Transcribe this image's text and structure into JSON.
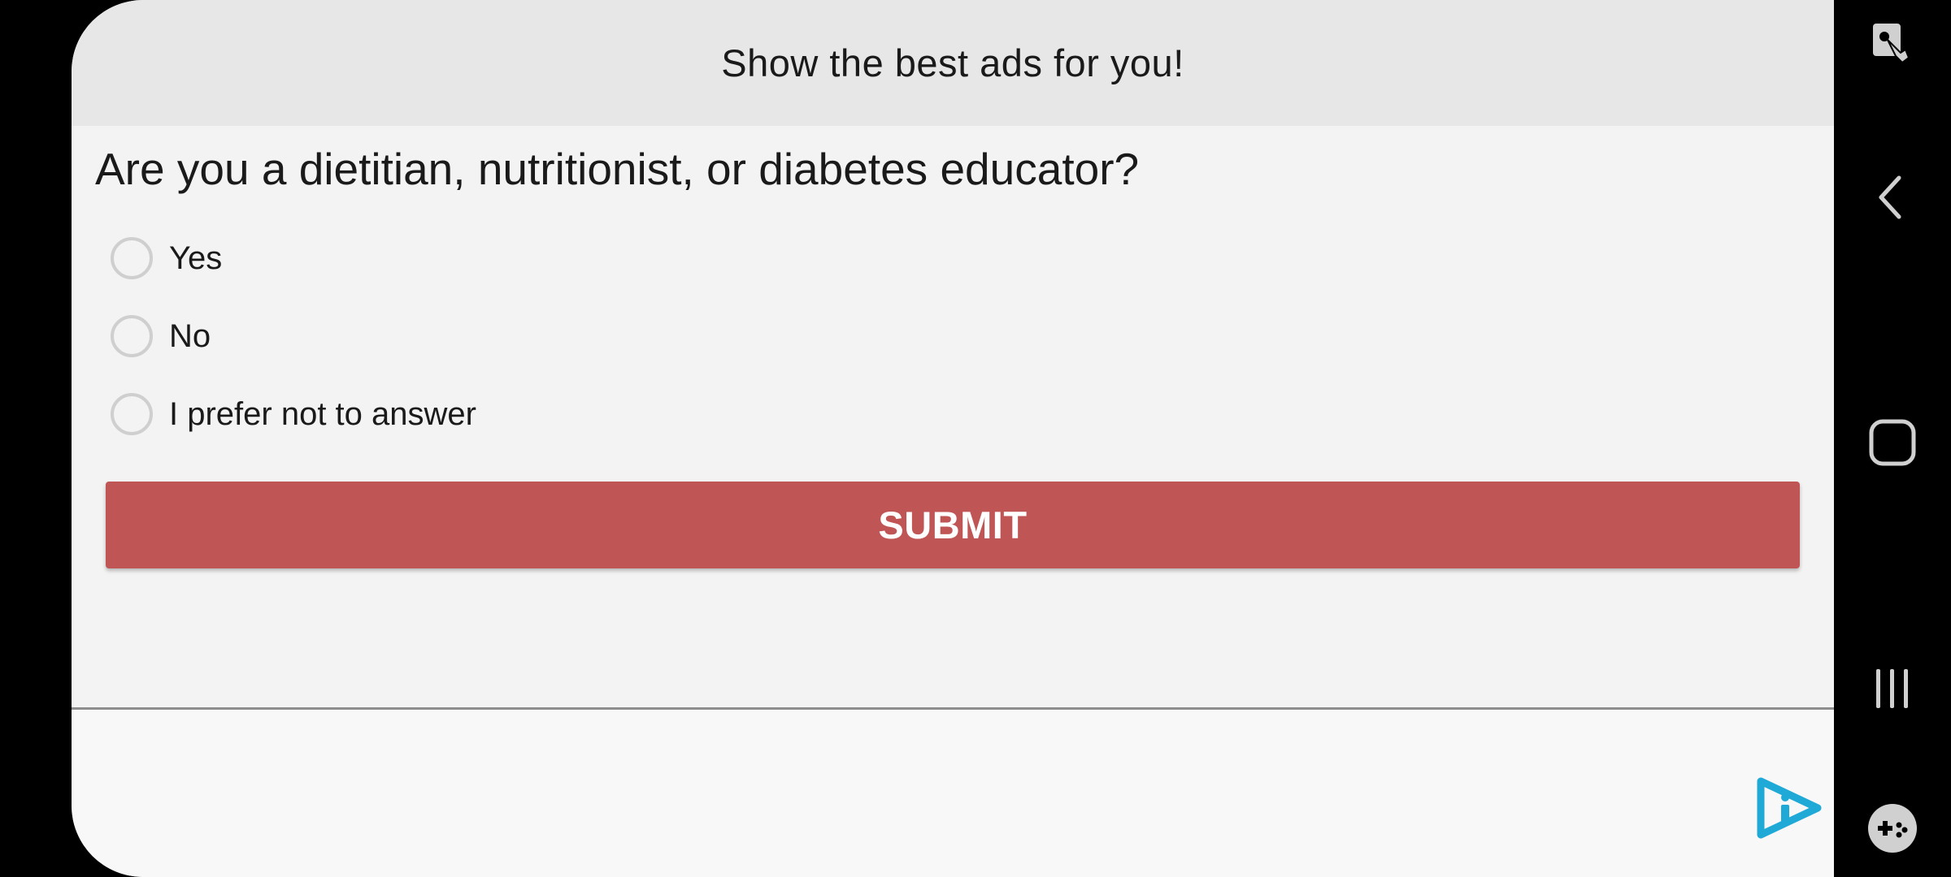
{
  "header": {
    "title": "Show the best ads for you!"
  },
  "survey": {
    "question": "Are you a dietitian, nutritionist, or diabetes educator?",
    "options": [
      {
        "label": "Yes",
        "selected": false
      },
      {
        "label": "No",
        "selected": false
      },
      {
        "label": "I prefer not to answer",
        "selected": false
      }
    ],
    "submit_label": "SUBMIT"
  },
  "colors": {
    "header_bg": "#e7e7e7",
    "content_bg": "#f3f3f3",
    "submit_bg": "#c05556",
    "ad_logo": "#1fa9d6",
    "nav_icons": "#d0d0d0"
  },
  "icons": {
    "ad_logo": "play-info-icon",
    "nav_top": "screen-touch-icon",
    "nav_back": "chevron-left-icon",
    "nav_home": "rounded-square-icon",
    "nav_recents": "three-bars-icon",
    "nav_game": "gamepad-icon"
  }
}
